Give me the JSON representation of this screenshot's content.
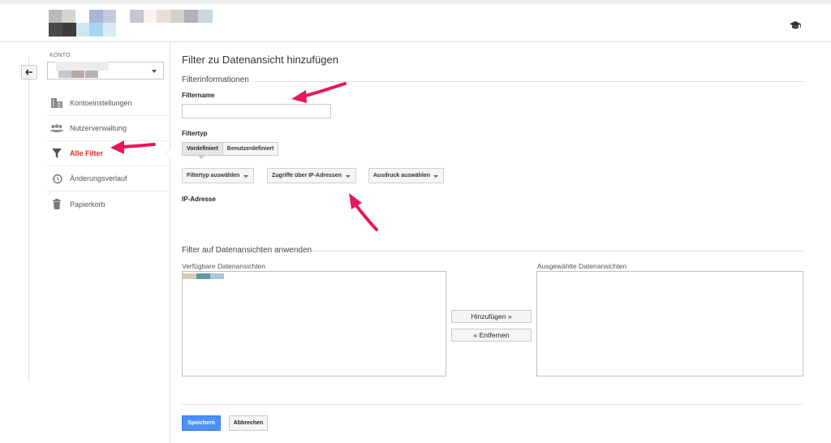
{
  "colors": {
    "accent_red": "#d62c2c",
    "annotation_arrow": "#e8175d",
    "primary_button": "#4d90fe"
  },
  "header": {
    "logo_icon": "blurred-logo",
    "help_icon": "graduation-cap-icon"
  },
  "sidebar": {
    "back_icon": "arrow-left-icon",
    "account_label": "KONTO",
    "items": [
      {
        "label": "Kontoeinstellungen",
        "icon": "building-icon",
        "active": false
      },
      {
        "label": "Nutzerverwaltung",
        "icon": "users-icon",
        "active": false
      },
      {
        "label": "Alle Filter",
        "icon": "filter-icon",
        "active": true
      },
      {
        "label": "Änderungsverlauf",
        "icon": "history-icon",
        "active": false
      },
      {
        "label": "Papierkorb",
        "icon": "trash-icon",
        "active": false
      }
    ]
  },
  "main": {
    "title": "Filter zu Datenansicht hinzufügen",
    "filter_info_heading": "Filterinformationen",
    "filter_name_label": "Filtername",
    "filter_name_value": "",
    "filter_type_label": "Filtertyp",
    "filter_type_tabs": [
      {
        "label": "Vordefiniert",
        "selected": true
      },
      {
        "label": "Benutzerdefiniert",
        "selected": false
      }
    ],
    "dropdowns": [
      {
        "label": "Filtertyp auswählen"
      },
      {
        "label": "Zugriffe über IP-Adressen"
      },
      {
        "label": "Ausdruck auswählen"
      }
    ],
    "ip_label": "IP-Adresse",
    "apply_heading": "Filter auf Datenansichten anwenden",
    "available_label": "Verfügbare Datenansichten",
    "selected_label": "Ausgewählte Datenansichten",
    "add_button": "Hinzufügen »",
    "remove_button": "« Entfernen",
    "save_button": "Speichern",
    "cancel_button": "Abbrechen"
  }
}
